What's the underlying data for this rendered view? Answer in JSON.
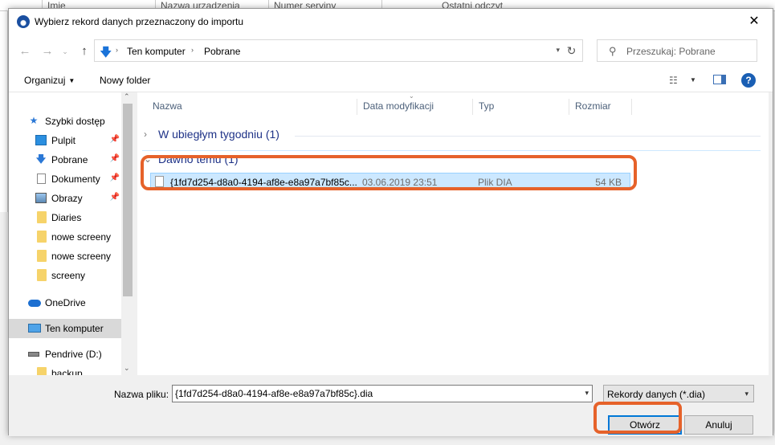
{
  "background_app": {
    "columns": [
      "Imie",
      "Nazwa urzadzenia",
      "Numer seryjny",
      "Ostatni odczyt"
    ]
  },
  "dialog": {
    "title": "Wybierz rekord danych przeznaczony do importu",
    "close_glyph": "✕"
  },
  "address": {
    "crumbs": [
      "Ten komputer",
      "Pobrane"
    ]
  },
  "search": {
    "placeholder": "Przeszukaj: Pobrane"
  },
  "toolbar": {
    "organize_label": "Organizuj",
    "new_folder_label": "Nowy folder",
    "help_glyph": "?"
  },
  "nav": {
    "items": [
      {
        "label": "Szybki dostęp",
        "icon": "star-icon",
        "pinned": false
      },
      {
        "label": "Pulpit",
        "icon": "desktop-icon",
        "pinned": true
      },
      {
        "label": "Pobrane",
        "icon": "download-icon",
        "pinned": true
      },
      {
        "label": "Dokumenty",
        "icon": "document-icon",
        "pinned": true
      },
      {
        "label": "Obrazy",
        "icon": "pictures-icon",
        "pinned": true
      },
      {
        "label": "Diaries",
        "icon": "folder-icon",
        "pinned": false
      },
      {
        "label": "nowe screeny",
        "icon": "folder-icon",
        "pinned": false
      },
      {
        "label": "nowe screeny",
        "icon": "folder-icon",
        "pinned": false
      },
      {
        "label": "screeny",
        "icon": "folder-icon",
        "pinned": false
      },
      {
        "label": "OneDrive",
        "icon": "cloud-icon",
        "pinned": false
      },
      {
        "label": "Ten komputer",
        "icon": "computer-icon",
        "pinned": false,
        "selected": true
      },
      {
        "label": "Pendrive (D:)",
        "icon": "drive-icon",
        "pinned": false
      },
      {
        "label": "backup",
        "icon": "folder-icon",
        "pinned": false
      }
    ]
  },
  "filelist": {
    "columns": [
      "Nazwa",
      "Data modyfikacji",
      "Typ",
      "Rozmiar"
    ],
    "groups": [
      {
        "label": "W ubiegłym tygodniu (1)",
        "expanded": false
      },
      {
        "label": "Dawno temu (1)",
        "expanded": true
      }
    ],
    "files": [
      {
        "name": "{1fd7d254-d8a0-4194-af8e-e8a97a7bf85c...",
        "date": "03.06.2019 23:51",
        "type": "Plik DIA",
        "size": "54 KB"
      }
    ]
  },
  "bottom": {
    "filename_label": "Nazwa pliku:",
    "filename_value": "{1fd7d254-d8a0-4194-af8e-e8a97a7bf85c}.dia",
    "filter_value": "Rekordy danych (*.dia)",
    "open_label": "Otwórz",
    "cancel_label": "Anuluj"
  },
  "colors": {
    "highlight": "#e6622a",
    "selection": "#cce8ff",
    "group_text": "#1e3287"
  }
}
